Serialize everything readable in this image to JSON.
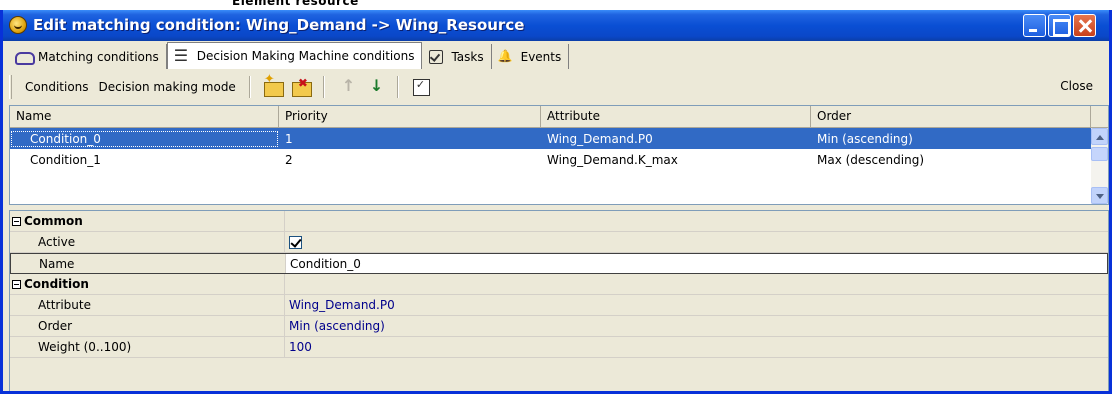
{
  "background_window": {
    "text": "Element resource"
  },
  "window": {
    "title": "Edit matching condition: Wing_Demand -> Wing_Resource"
  },
  "tabs": [
    {
      "label": "Matching conditions",
      "icon": "handshake-icon"
    },
    {
      "label": "Decision Making Machine conditions",
      "icon": "list-icon"
    },
    {
      "label": "Tasks",
      "icon": "task-check-icon"
    },
    {
      "label": "Events",
      "icon": "bell-icon"
    }
  ],
  "toolbar": {
    "conditions_label": "Conditions",
    "decision_mode_label": "Decision making mode",
    "close_label": "Close"
  },
  "grid": {
    "columns": [
      "Name",
      "Priority",
      "Attribute",
      "Order"
    ],
    "rows": [
      {
        "name": "Condition_0",
        "priority": "1",
        "attribute": "Wing_Demand.P0",
        "order": "Min (ascending)",
        "selected": true
      },
      {
        "name": "Condition_1",
        "priority": "2",
        "attribute": "Wing_Demand.K_max",
        "order": "Max (descending)",
        "selected": false
      }
    ]
  },
  "properties": {
    "common_label": "Common",
    "active_label": "Active",
    "active_value": true,
    "name_label": "Name",
    "name_value": "Condition_0",
    "condition_label": "Condition",
    "attribute_label": "Attribute",
    "attribute_value": "Wing_Demand.P0",
    "order_label": "Order",
    "order_value": "Min (ascending)",
    "weight_label": "Weight (0..100)",
    "weight_value": "100"
  },
  "colors": {
    "titlebar": "#0a4fd4",
    "selection": "#316ac5",
    "value_text": "#00008b",
    "window_bg": "#ece9d8"
  }
}
